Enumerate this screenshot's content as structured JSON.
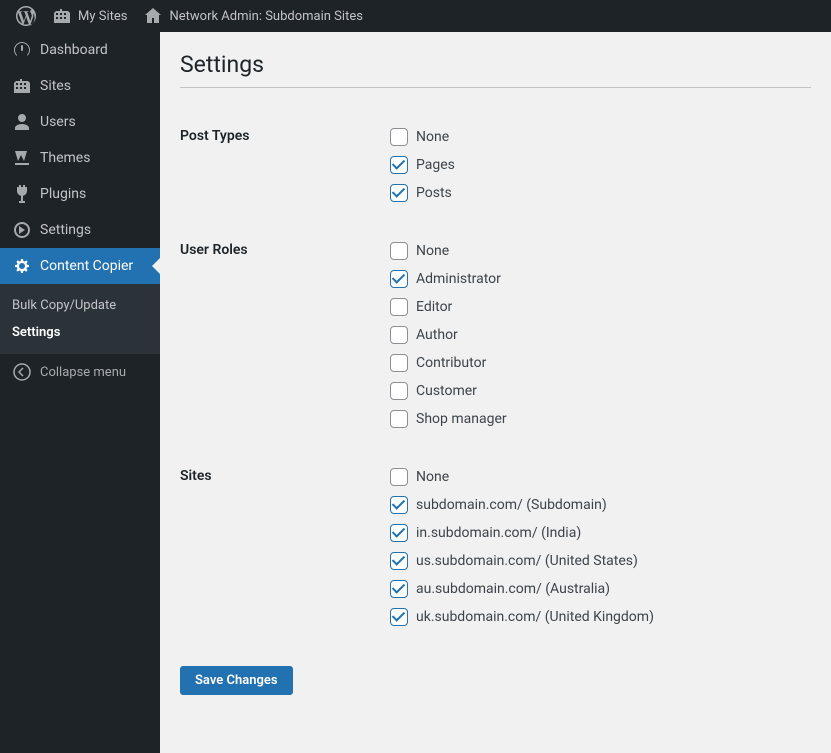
{
  "adminbar": {
    "mysites": "My Sites",
    "networkadmin": "Network Admin: Subdomain Sites"
  },
  "menu": {
    "dashboard": "Dashboard",
    "sites": "Sites",
    "users": "Users",
    "themes": "Themes",
    "plugins": "Plugins",
    "settings": "Settings",
    "contentcopier": "Content Copier",
    "sub_bulk": "Bulk Copy/Update",
    "sub_settings": "Settings",
    "collapse": "Collapse menu"
  },
  "page": {
    "title": "Settings",
    "save": "Save Changes"
  },
  "sections": {
    "posttypes": {
      "label": "Post Types",
      "items": [
        {
          "label": "None",
          "checked": false
        },
        {
          "label": "Pages",
          "checked": true
        },
        {
          "label": "Posts",
          "checked": true
        }
      ]
    },
    "userroles": {
      "label": "User Roles",
      "items": [
        {
          "label": "None",
          "checked": false
        },
        {
          "label": "Administrator",
          "checked": true
        },
        {
          "label": "Editor",
          "checked": false
        },
        {
          "label": "Author",
          "checked": false
        },
        {
          "label": "Contributor",
          "checked": false
        },
        {
          "label": "Customer",
          "checked": false
        },
        {
          "label": "Shop manager",
          "checked": false
        }
      ]
    },
    "sites": {
      "label": "Sites",
      "items": [
        {
          "label": "None",
          "checked": false
        },
        {
          "label": "subdomain.com/ (Subdomain)",
          "checked": true
        },
        {
          "label": "in.subdomain.com/ (India)",
          "checked": true
        },
        {
          "label": "us.subdomain.com/ (United States)",
          "checked": true
        },
        {
          "label": "au.subdomain.com/ (Australia)",
          "checked": true
        },
        {
          "label": "uk.subdomain.com/ (United Kingdom)",
          "checked": true
        }
      ]
    }
  }
}
